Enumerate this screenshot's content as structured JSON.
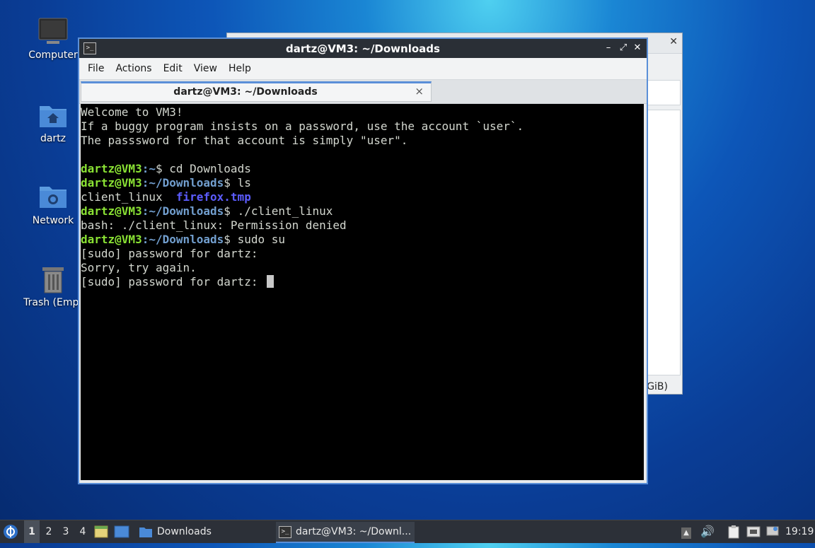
{
  "desktop": {
    "icons": [
      {
        "label": "Computer"
      },
      {
        "label": "dartz"
      },
      {
        "label": "Network"
      },
      {
        "label": "Trash (Empt"
      }
    ]
  },
  "background_window": {
    "partial_text": "GiB)"
  },
  "terminal_window": {
    "title": "dartz@VM3: ~/Downloads",
    "buttons": {
      "minimize": "–",
      "maximize": "⤢",
      "close": "✕"
    },
    "menu": [
      "File",
      "Actions",
      "Edit",
      "View",
      "Help"
    ],
    "tab": {
      "title": "dartz@VM3: ~/Downloads",
      "close": "×"
    },
    "lines": {
      "l1": "Welcome to VM3!",
      "l2": "If a buggy program insists on a password, use the account `user`.",
      "l3": "The passsword for that account is simply \"user\".",
      "prompt_user": "dartz@VM3",
      "c1_path": ":~",
      "c1_cmd": "$ cd Downloads",
      "dl_path": ":~/Downloads",
      "c2_cmd": "$ ls",
      "ls_file1": "client_linux  ",
      "ls_file2": "firefox.tmp",
      "c3_cmd": "$ ./client_linux",
      "err": "bash: ./client_linux: Permission denied",
      "c4_cmd": "$ sudo su",
      "sudo1": "[sudo] password for dartz:",
      "sorry": "Sorry, try again.",
      "sudo2": "[sudo] password for dartz: "
    }
  },
  "taskbar": {
    "workspaces": [
      "1",
      "2",
      "3",
      "4"
    ],
    "tasks": [
      {
        "label": "Downloads"
      },
      {
        "label": "dartz@VM3: ~/Downl..."
      }
    ],
    "clock": "19:19"
  }
}
